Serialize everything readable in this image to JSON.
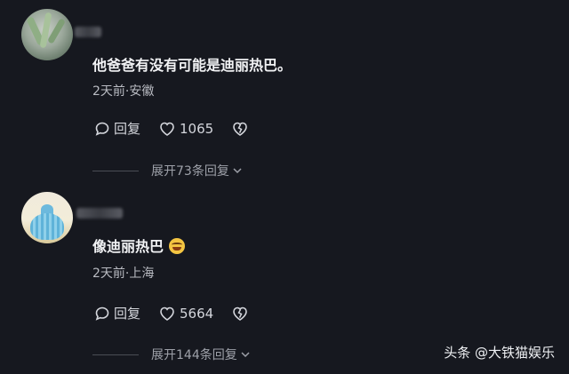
{
  "comments": [
    {
      "text": "他爸爸有没有可能是迪丽热巴。",
      "meta": "2天前·安徽",
      "reply_label": "回复",
      "likes": "1065",
      "expand_label": "展开73条回复"
    },
    {
      "text": "像迪丽热巴",
      "meta": "2天前·上海",
      "reply_label": "回复",
      "likes": "5664",
      "expand_label": "展开144条回复"
    }
  ],
  "watermark": "头条 @大铁猫娱乐",
  "icons": {
    "reply": "comment-bubble-icon",
    "like": "heart-outline-icon",
    "dislike": "broken-heart-icon",
    "expand": "chevron-down-icon",
    "emoji": "laughing-tears-emoji-icon"
  },
  "colors": {
    "background": "#16181f",
    "text": "#f1f2f4",
    "secondary": "#b9bbc2"
  }
}
